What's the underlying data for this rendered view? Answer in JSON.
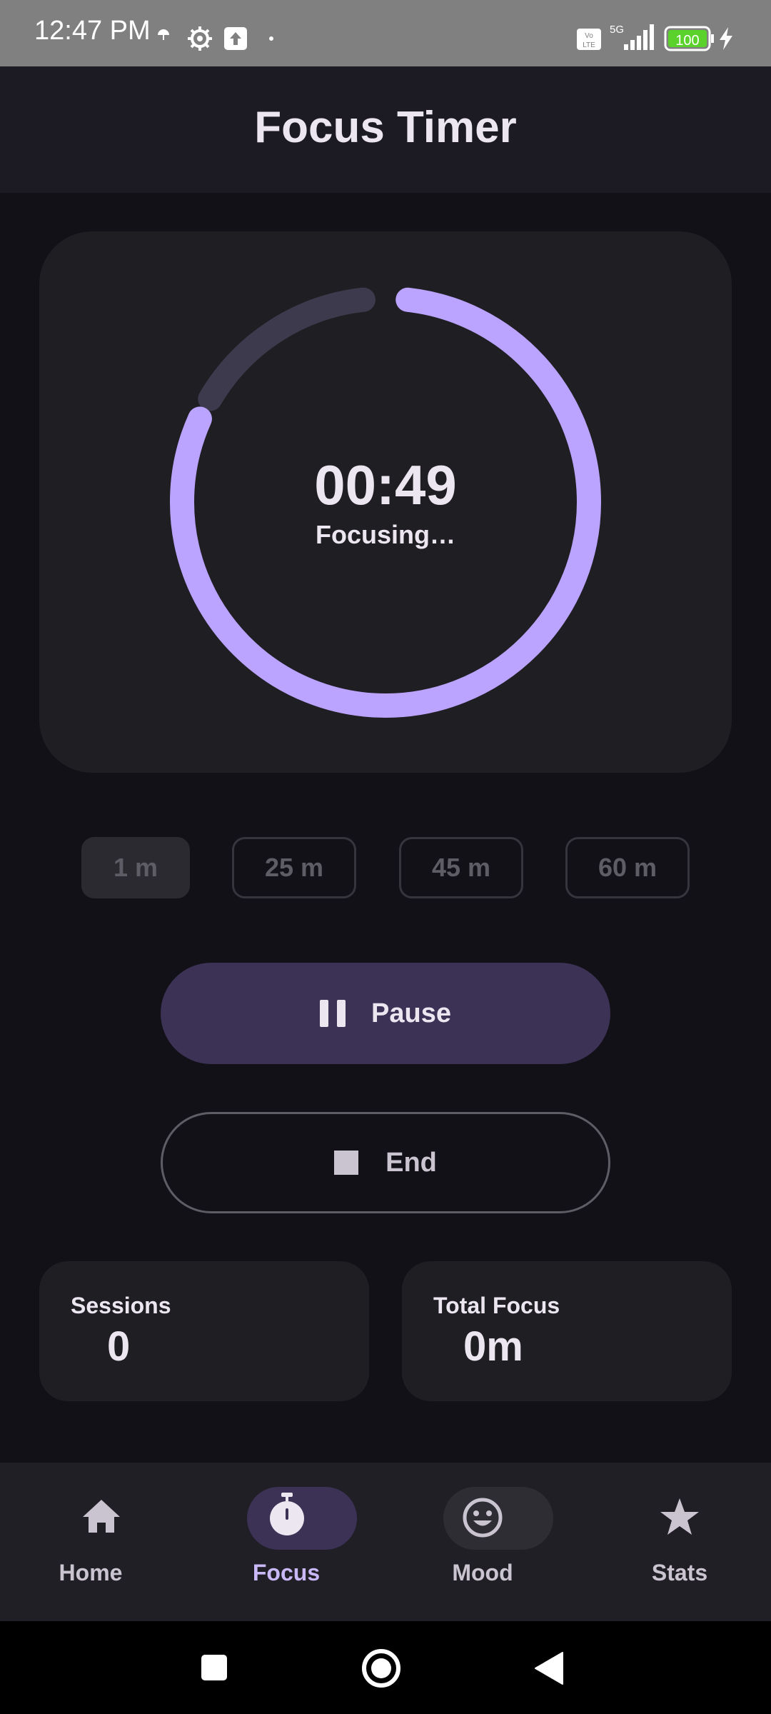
{
  "status_bar": {
    "time": "12:47 PM",
    "battery": "100",
    "network": "5G",
    "volte": "Vo LTE",
    "icons": [
      "umbrella-icon",
      "settings-gear-icon",
      "upload-icon",
      "dot-icon",
      "volte-icon",
      "signal-icon",
      "battery-icon",
      "charging-icon"
    ]
  },
  "app_bar": {
    "title": "Focus Timer"
  },
  "timer": {
    "time": "00:49",
    "status": "Focusing…",
    "progress": 0.817,
    "colors": {
      "progress": "#BBA4FF",
      "track": "#3E3A4E"
    }
  },
  "durations": [
    {
      "label": "1 m",
      "selected": true
    },
    {
      "label": "25 m",
      "selected": false
    },
    {
      "label": "45 m",
      "selected": false
    },
    {
      "label": "60 m",
      "selected": false
    }
  ],
  "controls": {
    "pause_label": "Pause",
    "end_label": "End"
  },
  "stats": {
    "sessions_label": "Sessions",
    "sessions_value": "0",
    "total_label": "Total Focus",
    "total_value": "0m"
  },
  "nav": {
    "items": [
      {
        "label": "Home",
        "icon": "home-icon",
        "active": false
      },
      {
        "label": "Focus",
        "icon": "stopwatch-icon",
        "active": true
      },
      {
        "label": "Mood",
        "icon": "smiley-icon",
        "active": false
      },
      {
        "label": "Stats",
        "icon": "star-icon",
        "active": false
      }
    ]
  },
  "system_nav": {
    "icons": [
      "recents-icon",
      "home-circle-icon",
      "back-icon"
    ]
  }
}
